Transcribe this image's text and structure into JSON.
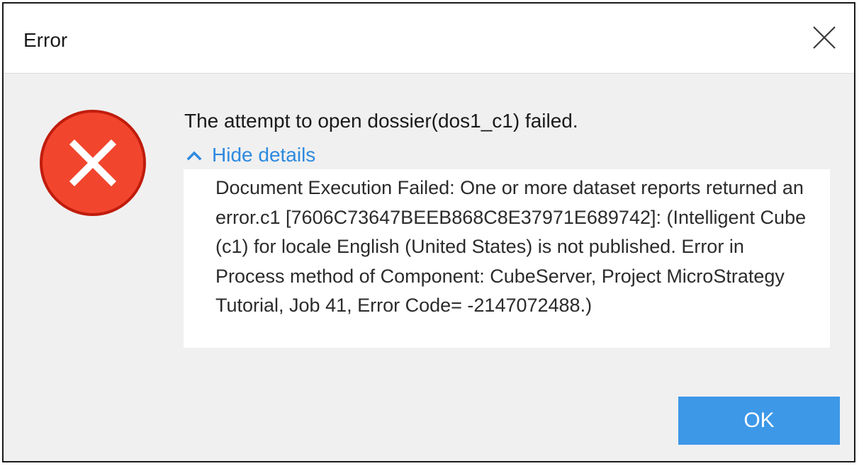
{
  "window": {
    "title": "Error"
  },
  "dialog": {
    "message": "The attempt to open dossier(dos1_c1) failed.",
    "details_toggle_label": "Hide details",
    "details_text": "Document Execution Failed: One or more dataset reports returned an error.c1 [7606C73647BEEB868C8E37971E689742]: (Intelligent Cube (c1) for locale English (United States) is not published. Error in Process method of Component: CubeServer, Project MicroStrategy Tutorial, Job 41, Error Code= -2147072488.)",
    "ok_label": "OK"
  },
  "icons": {
    "close": "close-icon",
    "error": "error-icon",
    "toggle": "chevron-up-icon"
  },
  "colors": {
    "error_red": "#f2452e",
    "error_ring": "#c01c0c",
    "link_blue": "#2d8ae0",
    "button_blue": "#3d98e8",
    "dialog_bg": "#f0f0f0"
  }
}
